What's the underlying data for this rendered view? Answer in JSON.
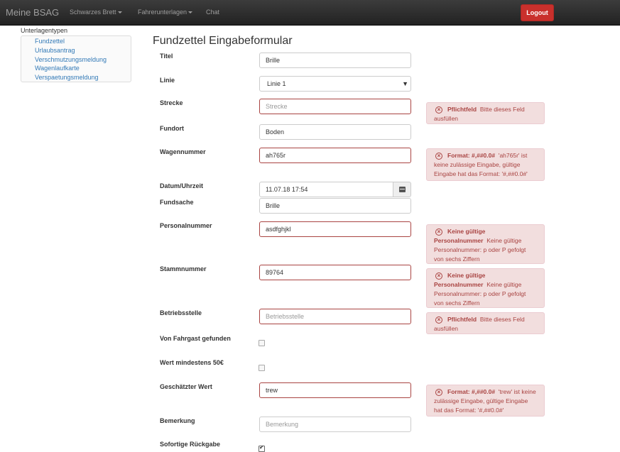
{
  "nav": {
    "brand": "Meine BSAG",
    "items": [
      "Schwarzes Brett",
      "Fahrerunterlagen",
      "Chat"
    ],
    "logout": "Logout"
  },
  "sidebar": {
    "title": "Unterlagentypen",
    "items": [
      "Fundzettel",
      "Urlaubsantrag",
      "Verschmutzungsmeldung",
      "Wagenlaufkarte",
      "Verspaetungsmeldung"
    ]
  },
  "page_title": "Fundzettel Eingabeformular",
  "fields": {
    "titel": {
      "label": "Titel",
      "value": "Brille"
    },
    "linie": {
      "label": "Linie",
      "value": "Linie 1"
    },
    "strecke": {
      "label": "Strecke",
      "placeholder": "Strecke"
    },
    "fundort": {
      "label": "Fundort",
      "value": "Boden"
    },
    "wagennummer": {
      "label": "Wagennummer",
      "value": "ah765r"
    },
    "datum": {
      "label": "Datum/Uhrzeit",
      "value": "11.07.18 17:54"
    },
    "fundsache": {
      "label": "Fundsache",
      "value": "Brille"
    },
    "personalnummer": {
      "label": "Personalnummer",
      "value": "asdfghjkl"
    },
    "stammnummer": {
      "label": "Stammnummer",
      "value": "89764"
    },
    "betriebsstelle": {
      "label": "Betriebsstelle",
      "placeholder": "Betriebsstelle"
    },
    "von_fahrgast": {
      "label": "Von Fahrgast gefunden",
      "checked": false
    },
    "wert50": {
      "label": "Wert mindestens 50€",
      "checked": false
    },
    "geschaetzter_wert": {
      "label": "Geschätzter Wert",
      "value": "trew"
    },
    "bemerkung": {
      "label": "Bemerkung",
      "placeholder": "Bemerkung"
    },
    "sofortige_rueckgabe": {
      "label": "Sofortige Rückgabe",
      "checked": true
    }
  },
  "errors": {
    "strecke": {
      "title": "Pflichtfeld",
      "text": "Bitte dieses Feld ausfüllen"
    },
    "wagennummer": {
      "title": "Format: #,##0.0#",
      "text": "'ah765r' ist keine zulässige Eingabe, gültige Eingabe hat das Format: '#,##0.0#'"
    },
    "personalnummer": {
      "title": "Keine gültige Personalnummer",
      "text": "Keine gültige Personalnummer: p oder P gefolgt von sechs Ziffern"
    },
    "stammnummer": {
      "title": "Keine gültige Personalnummer",
      "text": "Keine gültige Personalnummer: p oder P gefolgt von sechs Ziffern"
    },
    "betriebsstelle": {
      "title": "Pflichtfeld",
      "text": "Bitte dieses Feld ausfüllen"
    },
    "geschaetzter_wert": {
      "title": "Format: #,##0.0#",
      "text": "'trew' ist keine zulässige Eingabe, gültige Eingabe hat das Format: '#,##0.0#'"
    }
  },
  "icons": {
    "error": "error-circle-icon",
    "calendar": "calendar-icon",
    "dropdown": "dropdown-arrow-icon"
  },
  "colors": {
    "error": "#a94442",
    "error_bg": "#f2dede",
    "logout": "#c9302c",
    "link": "#337ab7"
  }
}
